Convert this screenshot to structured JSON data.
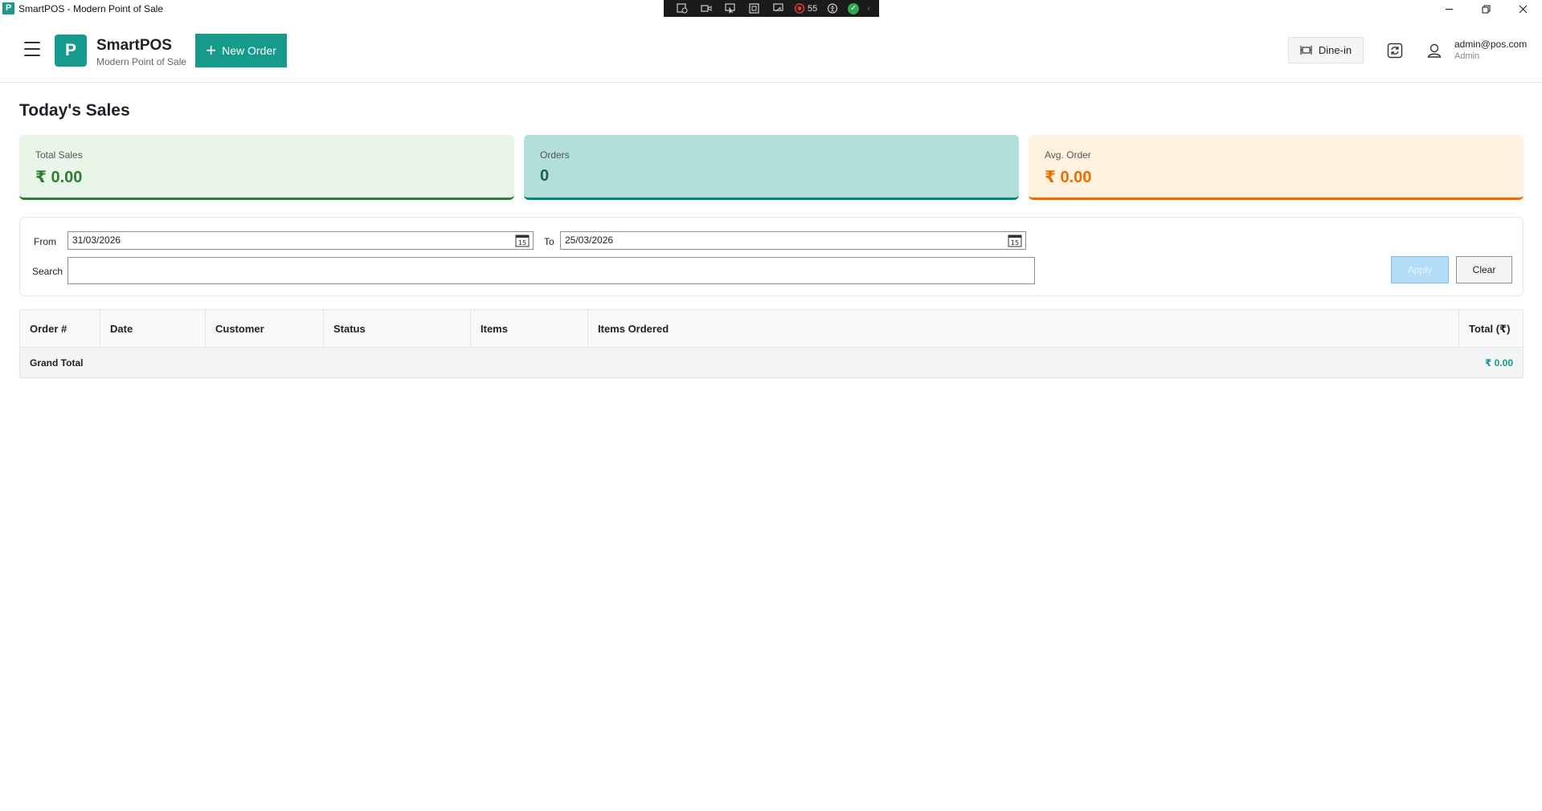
{
  "window": {
    "title": "SmartPOS - Modern Point of Sale",
    "logo_letter": "P",
    "recorder_count": "55"
  },
  "header": {
    "brand_letter": "P",
    "brand_name": "SmartPOS",
    "brand_subtitle": "Modern Point of Sale",
    "new_order_label": "New Order",
    "dine_in_label": "Dine-in",
    "user_email": "admin@pos.com",
    "user_role": "Admin"
  },
  "page": {
    "title": "Today's Sales"
  },
  "summary_cards": [
    {
      "label": "Total Sales",
      "value": "₹ 0.00",
      "color": "#2e7d32"
    },
    {
      "label": "Orders",
      "value": "0",
      "color": "#00897b"
    },
    {
      "label": "Avg. Order",
      "value": "₹ 0.00",
      "color": "#ef6c00"
    }
  ],
  "filters": {
    "from_label": "From",
    "from_value": "31/03/2026",
    "to_label": "To",
    "to_value": "25/03/2026",
    "search_label": "Search",
    "search_value": "",
    "apply_label": "Apply",
    "clear_label": "Clear"
  },
  "table": {
    "columns": [
      "Order #",
      "Date",
      "Customer",
      "Status",
      "Items",
      "Items Ordered",
      "Total (₹)"
    ],
    "rows": [],
    "grand_total_label": "Grand Total",
    "grand_total_value": "₹ 0.00"
  },
  "colors": {
    "brand": "#159a8c",
    "apply_disabled": "#b3dcf7"
  }
}
